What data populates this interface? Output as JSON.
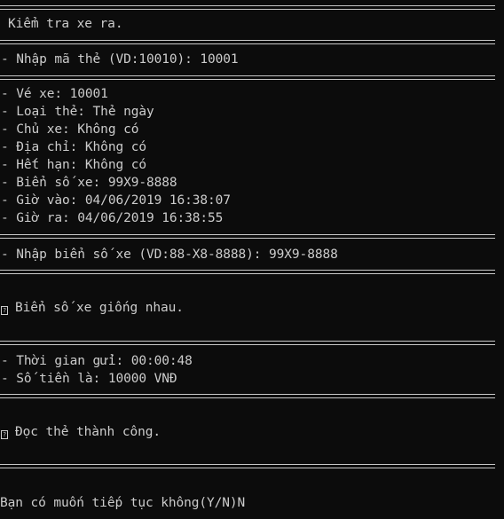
{
  "title": "Kiểm tra xe ra.",
  "card_prompt": "- Nhập mã thẻ (VD:10010): 10001",
  "ticket_info": [
    "- Vé xe: 10001",
    "- Loại thẻ: Thẻ ngày",
    "- Chủ xe: Không có",
    "- Địa chỉ: Không có",
    "- Hết hạn: Không có",
    "- Biển số xe: 99X9-8888",
    "- Giờ vào: 04/06/2019 16:38:07",
    "- Giờ ra: 04/06/2019 16:38:55"
  ],
  "plate_prompt": "- Nhập biển số xe (VD:88-X8-8888): 99X9-8888",
  "plate_match_message": "Biển số xe giống nhau.",
  "fee_info": [
    "- Thời gian gửi: 00:00:48",
    "- Số tiền là: 10000 VNĐ"
  ],
  "read_success_message": "Đọc thẻ thành công.",
  "continue_prompt": "Bạn có muốn tiếp tục không(Y/N)N"
}
